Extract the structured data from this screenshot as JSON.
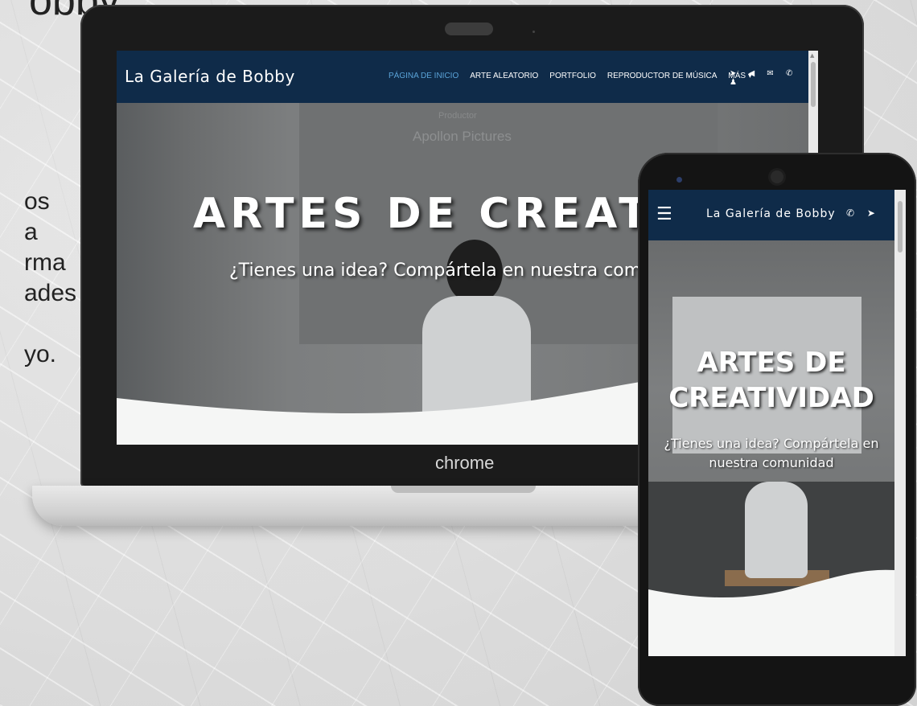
{
  "side": {
    "title": "obby",
    "lines": "os\na\nrma\nades\n\nyo."
  },
  "laptop": {
    "brand": "chrome"
  },
  "site": {
    "logo": "La Galería de Bobby",
    "menu": [
      "PÁGINA DE INICIO",
      "ARTE ALEATORIO",
      "PORTFOLIO",
      "REPRODUCTOR DE MÚSICA",
      "MÁS ▾"
    ],
    "menu_icons": "➤ ◀ ✉ ✆ ♟",
    "active_color": "#5aa3d8",
    "nav_color": "#0f2b49",
    "hero_credit_small": "Productor",
    "hero_credit_large": "Apollon Pictures",
    "hero_title": "ARTES DE CREATIVII",
    "hero_subtitle": "¿Tienes una idea? Compártela en nuestra com"
  },
  "mobile": {
    "burger": "☰",
    "logo": "La Galería de Bobby",
    "icons": "✆ ➤",
    "hero_title_line1": "ARTES DE",
    "hero_title_line2": "CREATIVIDAD",
    "hero_subtitle_line1": "¿Tienes una idea? Compártela en",
    "hero_subtitle_line2": "nuestra comunidad"
  }
}
